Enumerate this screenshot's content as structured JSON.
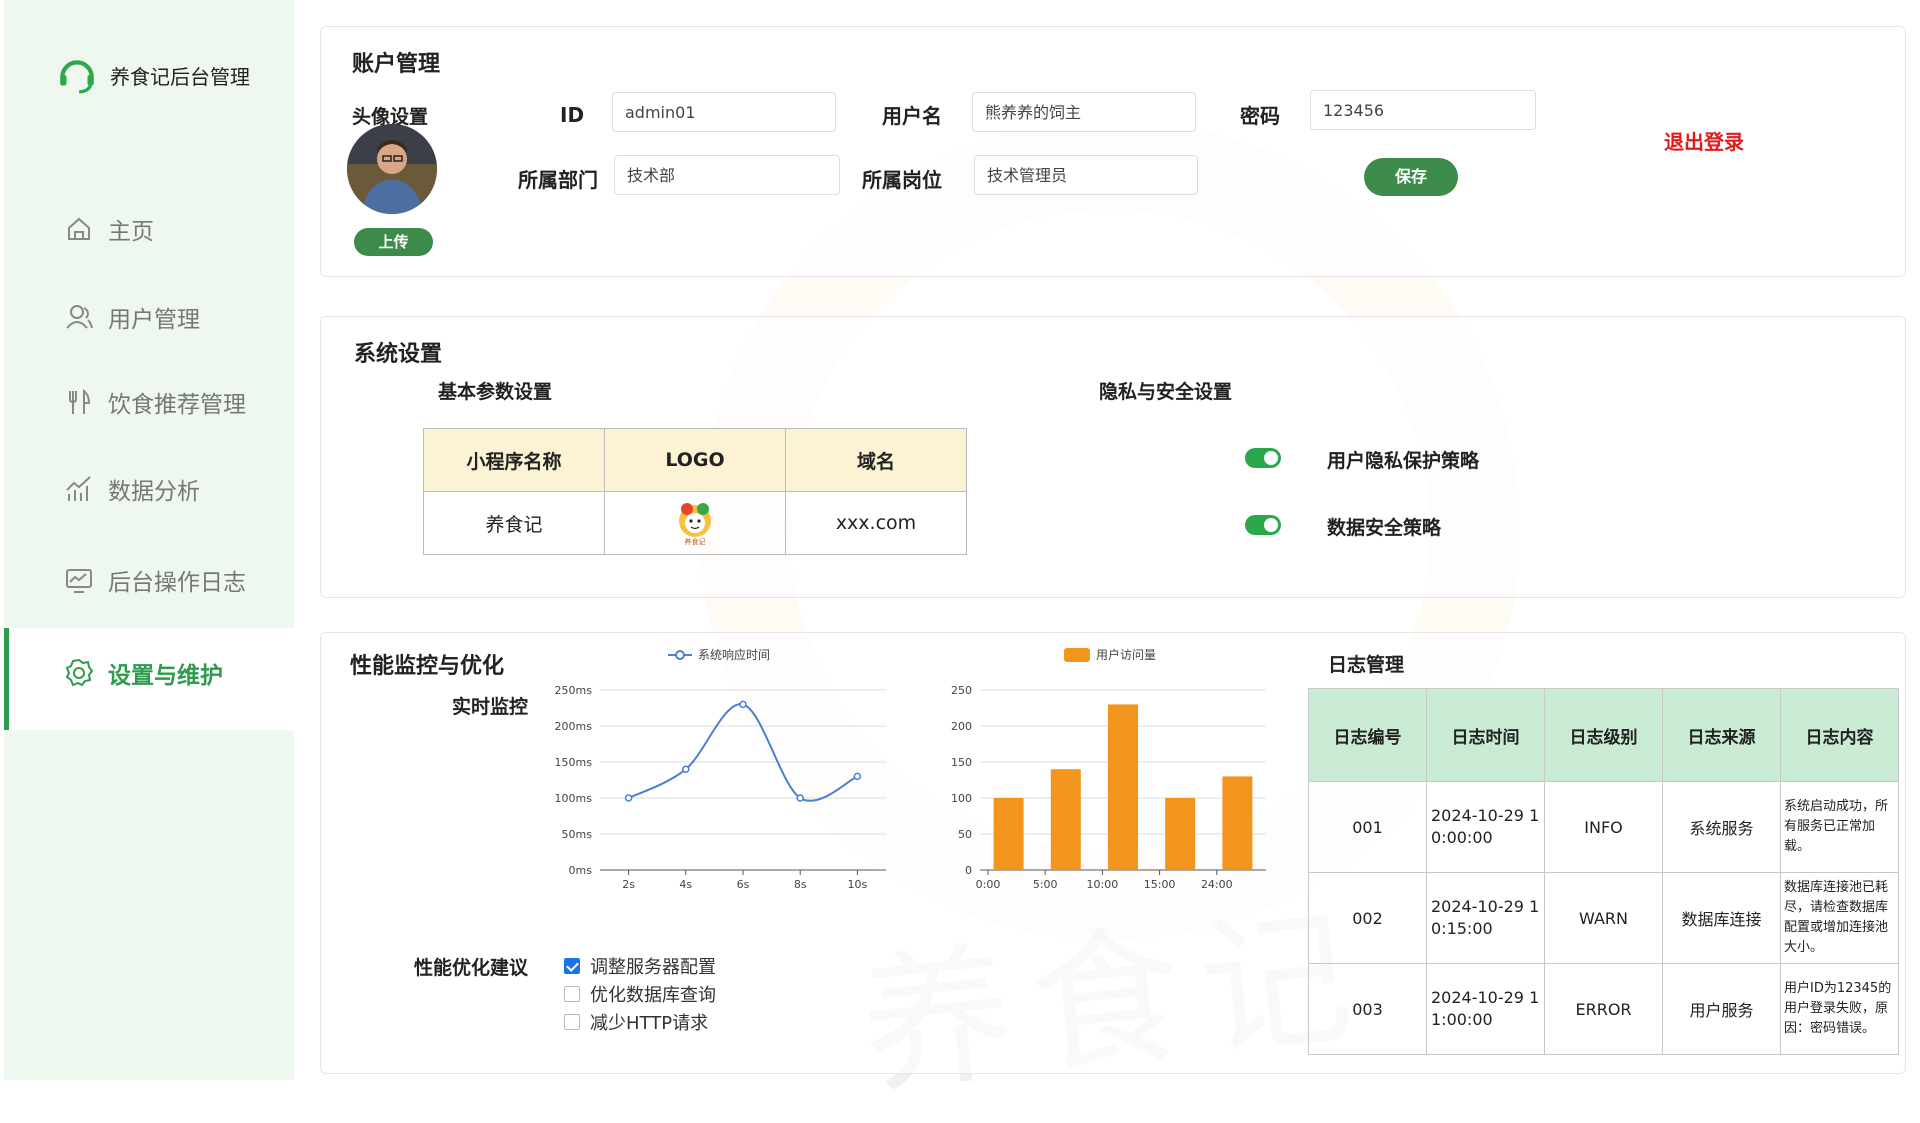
{
  "app": {
    "title": "养食记后台管理"
  },
  "sidebar": {
    "items": [
      {
        "label": "主页",
        "icon": "home-icon"
      },
      {
        "label": "用户管理",
        "icon": "user-icon"
      },
      {
        "label": "饮食推荐管理",
        "icon": "fork-knife-icon"
      },
      {
        "label": "数据分析",
        "icon": "chart-icon"
      },
      {
        "label": "后台操作日志",
        "icon": "monitor-icon"
      },
      {
        "label": "设置与维护",
        "icon": "gear-icon",
        "active": true
      }
    ]
  },
  "account": {
    "title": "账户管理",
    "avatar_label": "头像设置",
    "upload_label": "上传",
    "id_label": "ID",
    "id_value": "admin01",
    "username_label": "用户名",
    "username_value": "熊养养的饲主",
    "password_label": "密码",
    "password_value": "123456",
    "dept_label": "所属部门",
    "dept_value": "技术部",
    "post_label": "所属岗位",
    "post_value": "技术管理员",
    "save_label": "保存",
    "logout_label": "退出登录"
  },
  "system": {
    "title": "系统设置",
    "basic_label": "基本参数设置",
    "table_headers": [
      "小程序名称",
      "LOGO",
      "域名"
    ],
    "table_row": {
      "name": "养食记",
      "logo_text": "养食记",
      "domain": "xxx.com"
    },
    "privacy_label": "隐私与安全设置",
    "toggles": [
      {
        "label": "用户隐私保护策略",
        "on": true
      },
      {
        "label": "数据安全策略",
        "on": true
      }
    ]
  },
  "performance": {
    "title": "性能监控与优化",
    "realtime_label": "实时监控",
    "suggest_label": "性能优化建议",
    "suggestions": [
      {
        "label": "调整服务器配置",
        "checked": true
      },
      {
        "label": "优化数据库查询",
        "checked": false
      },
      {
        "label": "减少HTTP请求",
        "checked": false
      }
    ]
  },
  "chart_data": [
    {
      "type": "line",
      "series": [
        {
          "name": "系统响应时间",
          "values": [
            100,
            140,
            230,
            100,
            130
          ]
        }
      ],
      "x": [
        "2s",
        "4s",
        "6s",
        "8s",
        "10s"
      ],
      "y_ticks": [
        "0ms",
        "50ms",
        "100ms",
        "150ms",
        "200ms",
        "250ms"
      ],
      "ylim": [
        0,
        250
      ],
      "color": "#4a7fd4"
    },
    {
      "type": "bar",
      "series": [
        {
          "name": "用户访问量",
          "values": [
            100,
            140,
            230,
            100,
            130
          ]
        }
      ],
      "categories": [
        "0:00",
        "5:00",
        "10:00",
        "15:00",
        "24:00"
      ],
      "y_ticks": [
        "0",
        "50",
        "100",
        "150",
        "200",
        "250"
      ],
      "ylim": [
        0,
        250
      ],
      "color": "#f2951f"
    }
  ],
  "logs": {
    "title": "日志管理",
    "headers": [
      "日志编号",
      "日志时间",
      "日志级别",
      "日志来源",
      "日志内容"
    ],
    "rows": [
      {
        "id": "001",
        "time_a": "2024-10-29 1",
        "time_b": "0:00:00",
        "level": "INFO",
        "source": "系统服务",
        "content": "系统启动成功，所有服务已正常加载。"
      },
      {
        "id": "002",
        "time_a": "2024-10-29 1",
        "time_b": "0:15:00",
        "level": "WARN",
        "source": "数据库连接",
        "content": "数据库连接池已耗尽，请检查数据库配置或增加连接池大小。"
      },
      {
        "id": "003",
        "time_a": "2024-10-29 1",
        "time_b": "1:00:00",
        "level": "ERROR",
        "source": "用户服务",
        "content": "用户ID为12345的用户登录失败，原因：密码错误。"
      }
    ]
  },
  "watermark": {
    "text": "养食记"
  },
  "colors": {
    "accent": "#2d9c4c",
    "danger": "#e01b1b",
    "line": "#4a7fd4",
    "bar": "#f2951f"
  }
}
